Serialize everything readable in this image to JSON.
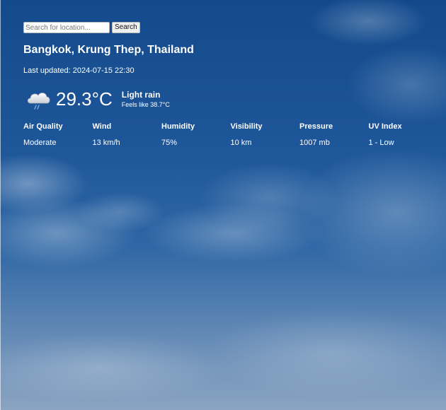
{
  "search": {
    "placeholder": "Search for location...",
    "value": "",
    "button_label": "Search"
  },
  "location": "Bangkok, Krung Thep, Thailand",
  "last_updated": "Last updated: 2024-07-15 22:30",
  "current": {
    "icon": "light-rain-cloud-icon",
    "temperature": "29.3°C",
    "condition": "Light rain",
    "feels_like": "Feels like 38.7°C"
  },
  "details": [
    {
      "label": "Air Quality",
      "value": "Moderate"
    },
    {
      "label": "Wind",
      "value": "13 km/h"
    },
    {
      "label": "Humidity",
      "value": "75%"
    },
    {
      "label": "Visibility",
      "value": "10 km"
    },
    {
      "label": "Pressure",
      "value": "1007 mb"
    },
    {
      "label": "UV Index",
      "value": "1 - Low"
    }
  ],
  "background": {
    "image": "blue-sky-with-clouds",
    "color": "#1f5394"
  }
}
